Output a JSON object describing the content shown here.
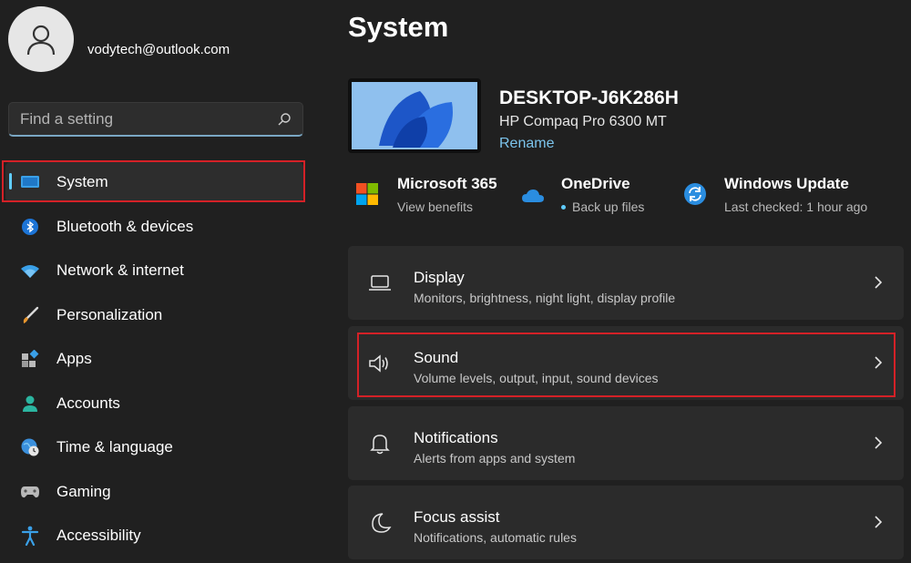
{
  "account": {
    "email": "vodytech@outlook.com"
  },
  "search": {
    "placeholder": "Find a setting"
  },
  "sidebar": {
    "items": [
      {
        "label": "System"
      },
      {
        "label": "Bluetooth & devices"
      },
      {
        "label": "Network & internet"
      },
      {
        "label": "Personalization"
      },
      {
        "label": "Apps"
      },
      {
        "label": "Accounts"
      },
      {
        "label": "Time & language"
      },
      {
        "label": "Gaming"
      },
      {
        "label": "Accessibility"
      }
    ]
  },
  "page": {
    "title": "System"
  },
  "device": {
    "name": "DESKTOP-J6K286H",
    "model": "HP Compaq Pro 6300 MT",
    "rename_label": "Rename"
  },
  "quick_links": [
    {
      "title": "Microsoft 365",
      "subtitle": "View benefits"
    },
    {
      "title": "OneDrive",
      "subtitle": "Back up files"
    },
    {
      "title": "Windows Update",
      "subtitle": "Last checked: 1 hour ago"
    }
  ],
  "settings": [
    {
      "title": "Display",
      "subtitle": "Monitors, brightness, night light, display profile"
    },
    {
      "title": "Sound",
      "subtitle": "Volume levels, output, input, sound devices"
    },
    {
      "title": "Notifications",
      "subtitle": "Alerts from apps and system"
    },
    {
      "title": "Focus assist",
      "subtitle": "Notifications, automatic rules"
    }
  ],
  "colors": {
    "background": "#202020",
    "card": "#2b2b2b",
    "accent": "#60cdff",
    "link": "#7cc4ec",
    "highlight": "#d42127"
  }
}
